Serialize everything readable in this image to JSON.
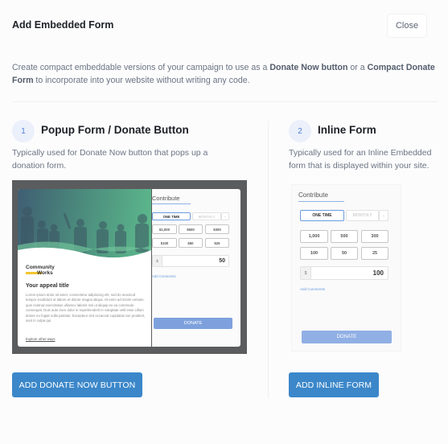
{
  "header": {
    "title": "Add Embedded Form",
    "close_label": "Close"
  },
  "intro": {
    "part1": "Create compact embeddable versions of your campaign to use as a ",
    "bold1": "Donate Now button",
    "part2": " or a ",
    "bold2": "Compact Donate Form",
    "part3": " to incorporate into your website without writing any code."
  },
  "sections": [
    {
      "step": "1",
      "title": "Popup Form / Donate Button",
      "description": "Typically used for Donate Now button that pops up a donation form.",
      "button_label": "ADD DONATE NOW BUTTON",
      "preview": {
        "logo_line1": "Community",
        "logo_line2": "Works",
        "appeal_title": "Your appeal title",
        "appeal_body": "Lorem ipsum dolor sit amet, consectetur adipiscing elit, sed do eiusmod tempor incididunt ut labore et dolore magna aliqua. Ut enim ad minim veniam, quis nostrud exercitation ullamco laboris nisi ut aliquip ex ea commodo consequat. Duis aute irure dolor in reprehenderit in voluptate velit esse cillum dolore eu fugiat nulla pariatur. Excepteur sint occaecat cupidatat non proident, sunt in culpa qui",
        "explore_link": "Explore other ways",
        "contribute_title": "Contribute",
        "frequency": [
          "ONE TIME",
          "MONTHLY"
        ],
        "frequency_dropdown": "⌄",
        "amounts": [
          "$1,000",
          "$500",
          "$300",
          "$100",
          "$50",
          "$25"
        ],
        "currency_symbol": "$",
        "amount_value": "50",
        "add_comments": "Add Comments",
        "donate_label": "DONATE"
      }
    },
    {
      "step": "2",
      "title": "Inline Form",
      "description": "Typically used for an Inline Embedded form that is displayed within your site.",
      "button_label": "ADD INLINE FORM",
      "preview": {
        "contribute_title": "Contribute",
        "frequency": [
          "ONE TIME",
          "MONTHLY"
        ],
        "frequency_dropdown": "⌄",
        "amounts": [
          "1,000",
          "500",
          "300",
          "100",
          "50",
          "25"
        ],
        "currency_symbol": "$",
        "amount_value": "100",
        "add_comments": "Add Comments",
        "donate_label": "DONATE"
      }
    }
  ],
  "colors": {
    "primary": "#3b87c9",
    "step_badge_bg": "#ebf0fb",
    "step_badge_text": "#4e7fd8",
    "donate_button": "#7ea1dd"
  }
}
